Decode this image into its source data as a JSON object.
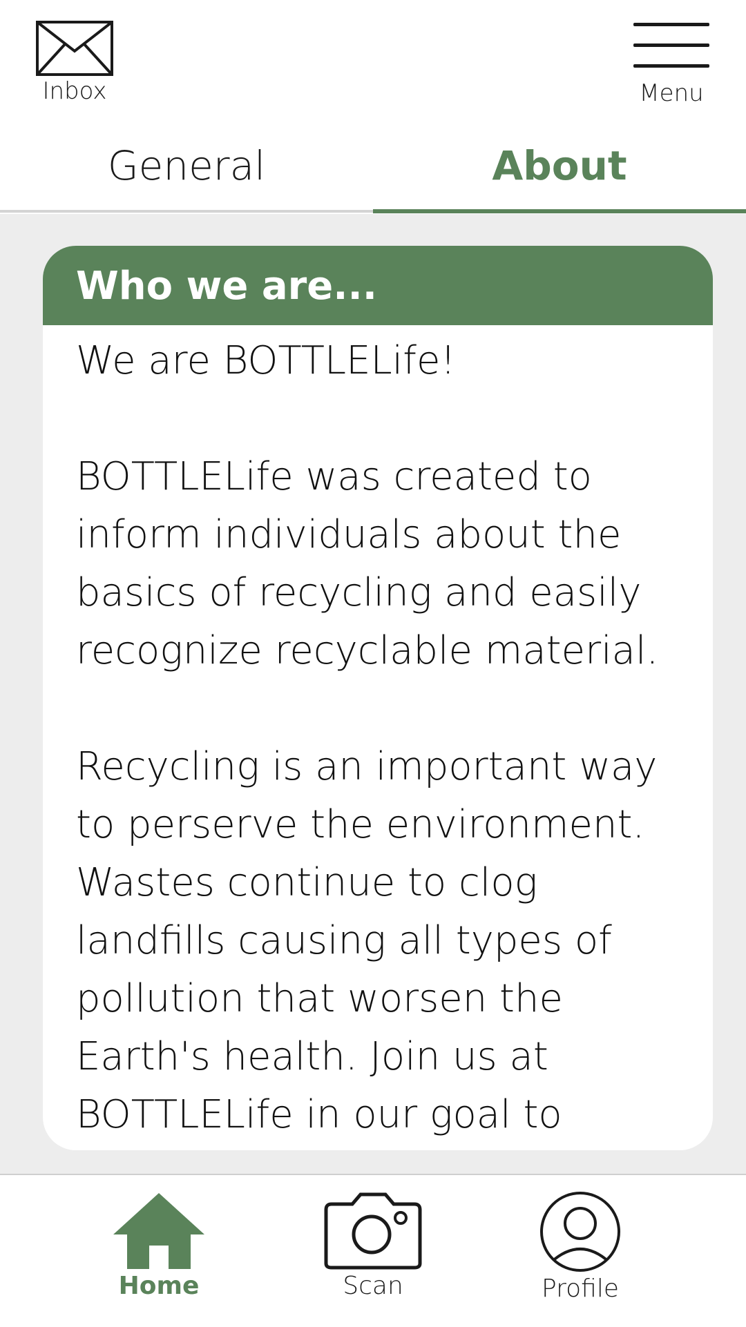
{
  "header": {
    "inbox_label": "Inbox",
    "menu_label": "Menu"
  },
  "tabs": [
    {
      "label": "General",
      "active": false
    },
    {
      "label": "About",
      "active": true
    }
  ],
  "card": {
    "title": "Who we are...",
    "paragraphs": [
      "We are BOTTLELife!",
      "BOTTLELife was created to inform individuals about the basics of recycling and easily recognize recyclable material.",
      "Recycling is an important way to perserve the environment. Wastes continue to clog landfills causing all types of pollution that worsen the Earth's health. Join us at BOTTLELife in our goal to create a greener Earth!"
    ]
  },
  "bottom_nav": [
    {
      "label": "Home",
      "icon": "home-icon",
      "active": true
    },
    {
      "label": "Scan",
      "icon": "camera-icon",
      "active": false
    },
    {
      "label": "Profile",
      "icon": "profile-icon",
      "active": false
    }
  ],
  "colors": {
    "accent": "#5a835a",
    "background": "#ededed",
    "surface": "#ffffff"
  }
}
